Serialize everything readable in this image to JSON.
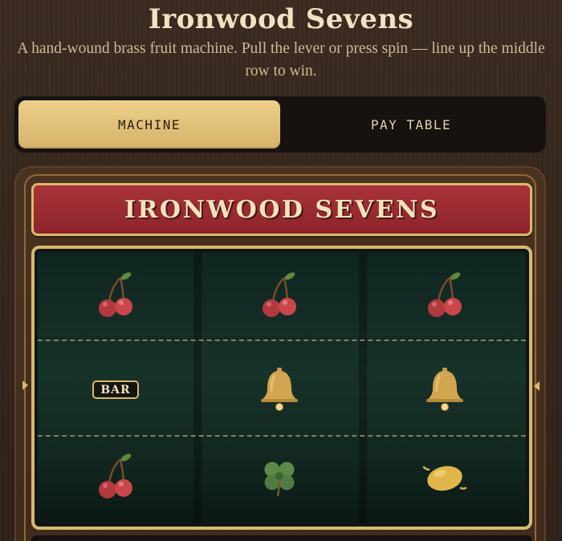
{
  "header": {
    "title": "Ironwood Sevens",
    "subtitle": "A hand-wound brass fruit machine. Pull the lever or press spin — line up the middle row to win."
  },
  "tabs": [
    {
      "label": "MACHINE",
      "active": true
    },
    {
      "label": "PAY TABLE",
      "active": false
    }
  ],
  "machine": {
    "banner": "IRONWOOD SEVENS",
    "reels": [
      [
        "cherry-icon",
        "bar-icon",
        "cherry-icon"
      ],
      [
        "cherry-icon",
        "bell-icon",
        "clover-icon"
      ],
      [
        "cherry-icon",
        "bell-icon",
        "lemon-icon"
      ]
    ],
    "bar_label": "BAR"
  },
  "colors": {
    "brass": "#d9b96c",
    "banner_red": "#9b2b32",
    "felt_green": "#173229",
    "wood": "#3a2a1f"
  }
}
